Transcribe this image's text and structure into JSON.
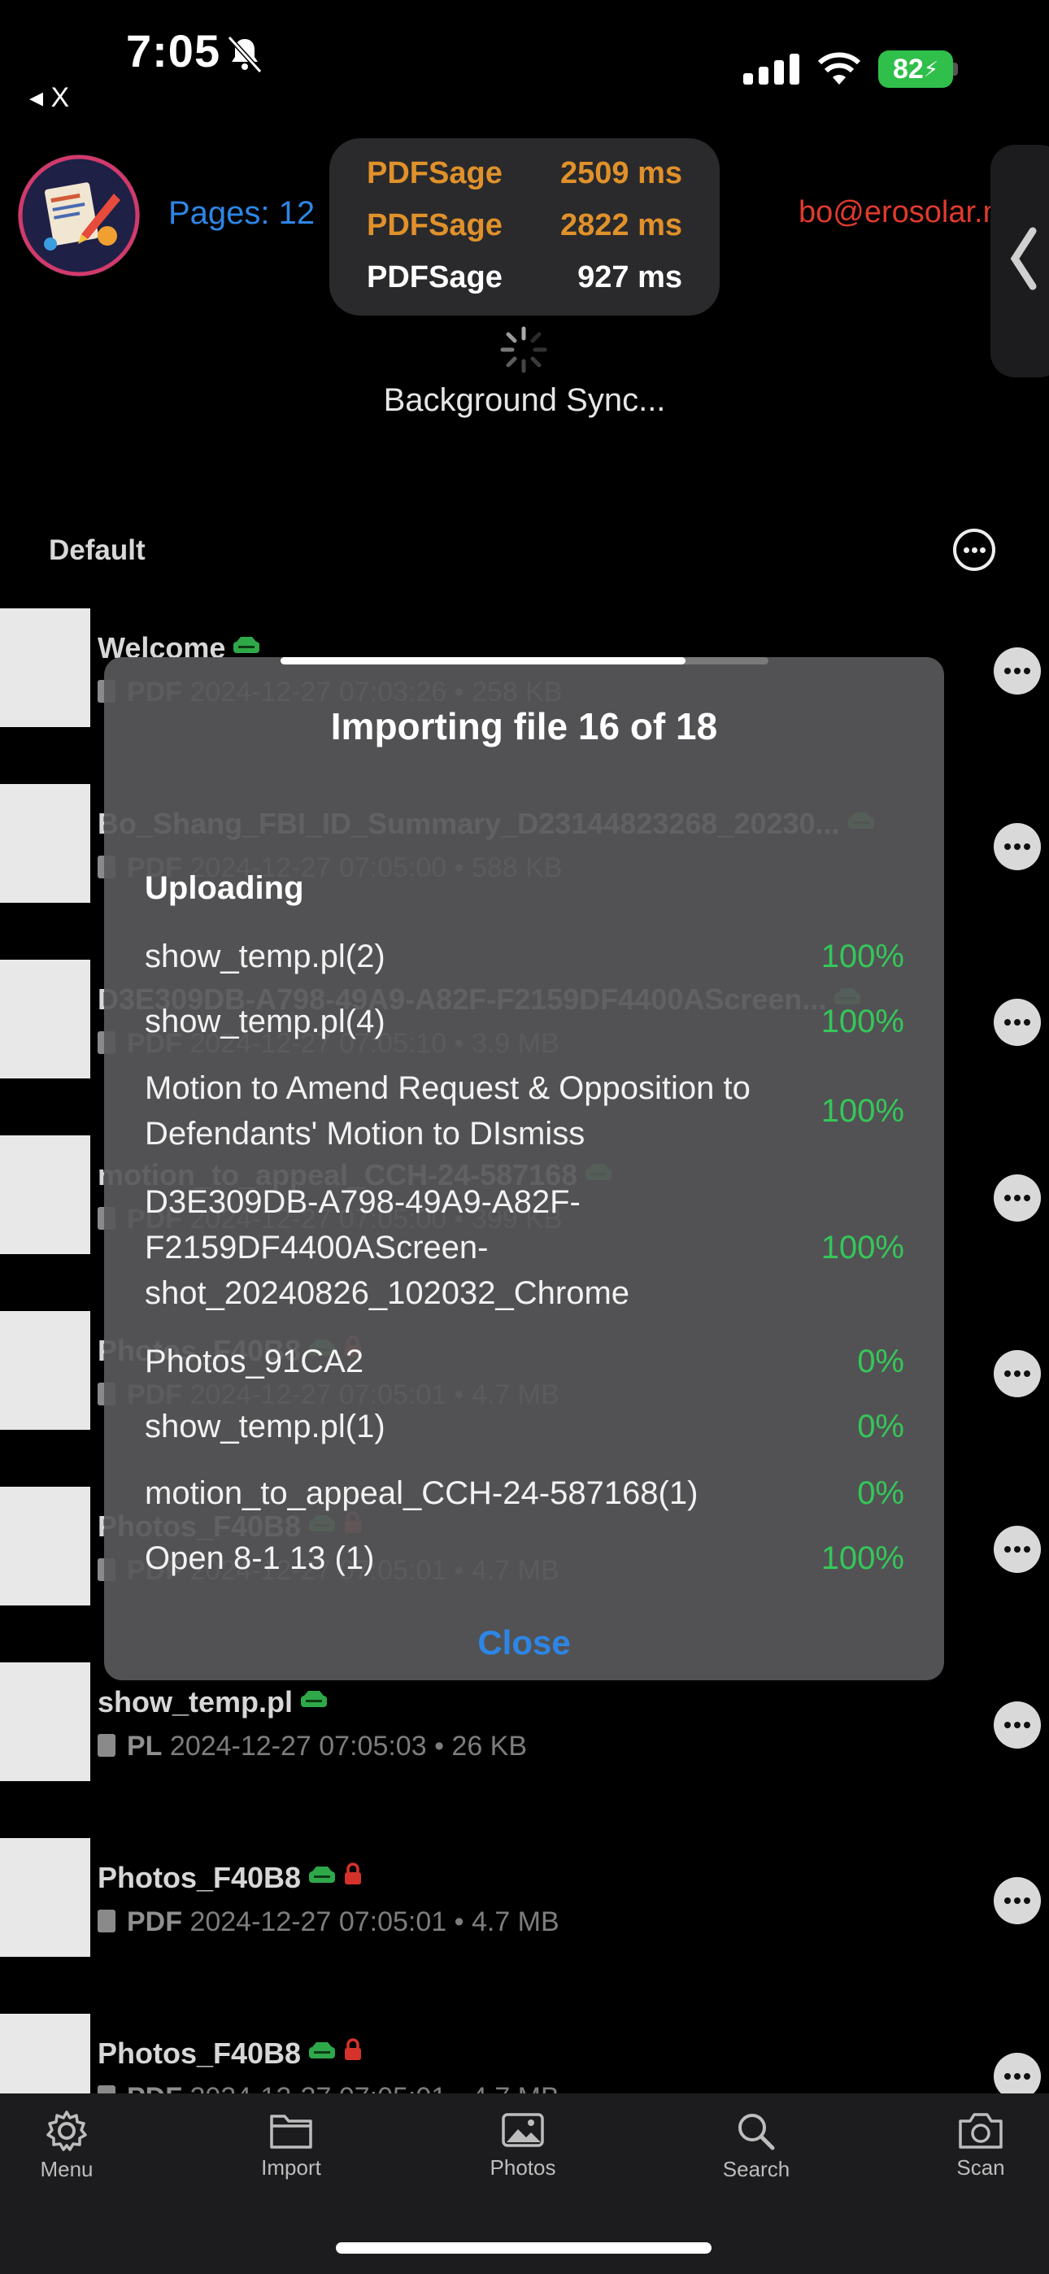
{
  "status_bar": {
    "time": "7:05",
    "battery": "82",
    "back_label": "◂ X"
  },
  "header": {
    "pages_label": "Pages: 12",
    "email": "bo@erosolar.n",
    "perf": [
      {
        "name": "PDFSage",
        "ms": "2509 ms",
        "color": "#e0912a"
      },
      {
        "name": "PDFSage",
        "ms": "2822 ms",
        "color": "#e0912a"
      },
      {
        "name": "PDFSage",
        "ms": "927 ms",
        "color": "#ffffff"
      }
    ],
    "sync_status": "Background Sync..."
  },
  "section": {
    "title": "Default"
  },
  "files": [
    {
      "name": "Welcome",
      "type": "PDF",
      "meta": "2024-12-27 07:03:26 • 258 KB",
      "locked": false
    },
    {
      "name": "Bo_Shang_FBI_ID_Summary_D23144823268_20230...",
      "type": "PDF",
      "meta": "2024-12-27 07:05:00 • 588 KB",
      "locked": false
    },
    {
      "name": "D3E309DB-A798-49A9-A82F-F2159DF4400AScreen...",
      "type": "PDF",
      "meta": "2024-12-27 07:05:10 • 3.9 MB",
      "locked": false
    },
    {
      "name": "motion_to_appeal_CCH-24-587168",
      "type": "PDF",
      "meta": "2024-12-27 07:05:00 • 399 KB",
      "locked": false
    },
    {
      "name": "Photos_F40B8",
      "type": "PDF",
      "meta": "2024-12-27 07:05:01 • 4.7 MB",
      "locked": true
    },
    {
      "name": "Photos_F40B8",
      "type": "PDF",
      "meta": "2024-12-27 07:05:01 • 4.7 MB",
      "locked": true
    },
    {
      "name": "show_temp.pl",
      "type": "PL",
      "meta": "2024-12-27 07:05:03 • 26 KB",
      "locked": false
    },
    {
      "name": "Photos_F40B8",
      "type": "PDF",
      "meta": "2024-12-27 07:05:01 • 4.7 MB",
      "locked": true
    },
    {
      "name": "Photos_F40B8",
      "type": "PDF",
      "meta": "2024-12-27 07:05:01 • 4.7 MB",
      "locked": true
    }
  ],
  "modal": {
    "title": "Importing file 16 of 18",
    "progress_fraction": 0.83,
    "section_label": "Uploading",
    "uploads": [
      {
        "name": "show_temp.pl(2)",
        "percent": "100%"
      },
      {
        "name": "show_temp.pl(4)",
        "percent": "100%"
      },
      {
        "name": "Motion to Amend Request & Opposition to Defendants' Motion to DIsmiss",
        "percent": "100%"
      },
      {
        "name": "D3E309DB-A798-49A9-A82F-F2159DF4400AScreen-shot_20240826_102032_Chrome",
        "percent": "100%"
      },
      {
        "name": "Photos_91CA2",
        "percent": "0%"
      },
      {
        "name": "show_temp.pl(1)",
        "percent": "0%"
      },
      {
        "name": "motion_to_appeal_CCH-24-587168(1)",
        "percent": "0%"
      },
      {
        "name": "Open 8-1 13 (1)",
        "percent": "100%"
      }
    ],
    "close_label": "Close"
  },
  "tabbar": [
    {
      "label": "Menu",
      "icon": "gear-icon"
    },
    {
      "label": "Import",
      "icon": "folder-icon"
    },
    {
      "label": "Photos",
      "icon": "photo-icon"
    },
    {
      "label": "Search",
      "icon": "search-icon"
    },
    {
      "label": "Scan",
      "icon": "camera-icon"
    }
  ]
}
